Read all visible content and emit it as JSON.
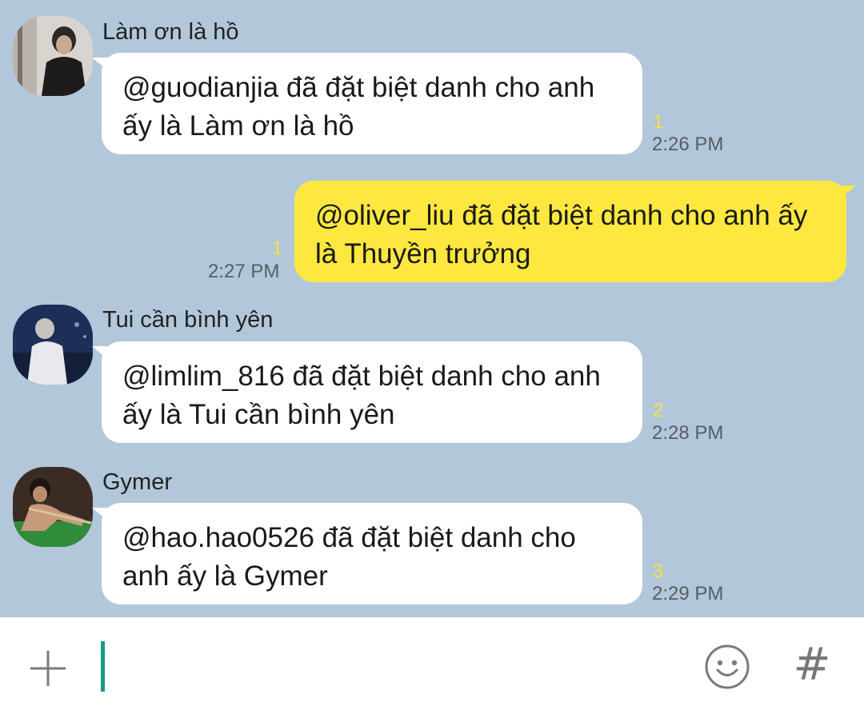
{
  "messages": [
    {
      "sender": "Làm ơn là hồ",
      "text": "@guodianjia đã đặt biệt danh cho anh ấy là Làm ơn là hồ",
      "unread": "1",
      "time": "2:26 PM",
      "outgoing": false
    },
    {
      "sender": "",
      "text": "@oliver_liu đã đặt biệt danh cho anh ấy là Thuyền trưởng",
      "unread": "1",
      "time": "2:27 PM",
      "outgoing": true
    },
    {
      "sender": "Tui cần bình yên",
      "text": "@limlim_816 đã đặt biệt danh cho anh ấy là Tui cần bình yên",
      "unread": "2",
      "time": "2:28 PM",
      "outgoing": false
    },
    {
      "sender": "Gymer",
      "text": "@hao.hao0526 đã đặt biệt danh cho anh ấy là Gymer",
      "unread": "3",
      "time": "2:29 PM",
      "outgoing": false
    }
  ],
  "input_bar": {
    "message_value": "",
    "plus_icon": "plus-icon",
    "emoji_icon": "smiley-icon",
    "hash_label": "#"
  },
  "colors": {
    "chat_background": "#b2c7d9",
    "incoming_bubble": "#ffffff",
    "outgoing_bubble": "#fee83f",
    "unread_count": "#f6e04a",
    "cursor": "#129a8a"
  }
}
